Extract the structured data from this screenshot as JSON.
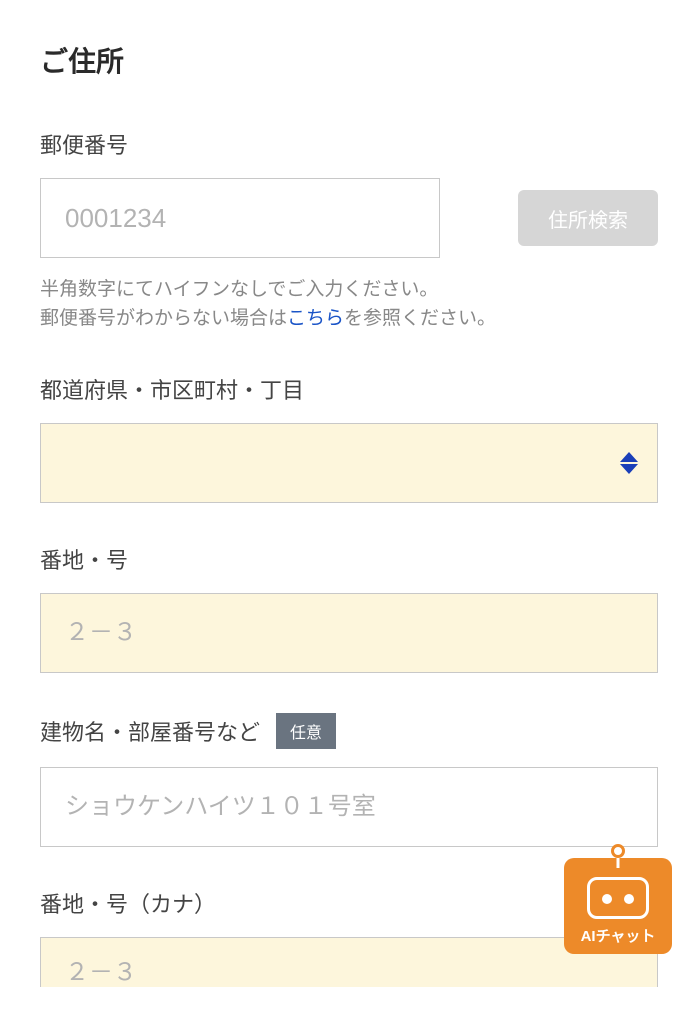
{
  "section_title": "ご住所",
  "postal": {
    "label": "郵便番号",
    "placeholder": "0001234",
    "search_button": "住所検索",
    "help_line1": "半角数字にてハイフンなしでご入力ください。",
    "help_line2_prefix": "郵便番号がわからない場合は",
    "help_link": "こちら",
    "help_line2_suffix": "を参照ください。"
  },
  "prefecture": {
    "label": "都道府県・市区町村・丁目"
  },
  "street": {
    "label": "番地・号",
    "placeholder": "２－３"
  },
  "building": {
    "label": "建物名・部屋番号など",
    "badge": "任意",
    "placeholder": "ショウケンハイツ１０１号室"
  },
  "street_kana": {
    "label": "番地・号（カナ）",
    "placeholder": "２－３"
  },
  "chat": {
    "label": "AIチャット"
  }
}
